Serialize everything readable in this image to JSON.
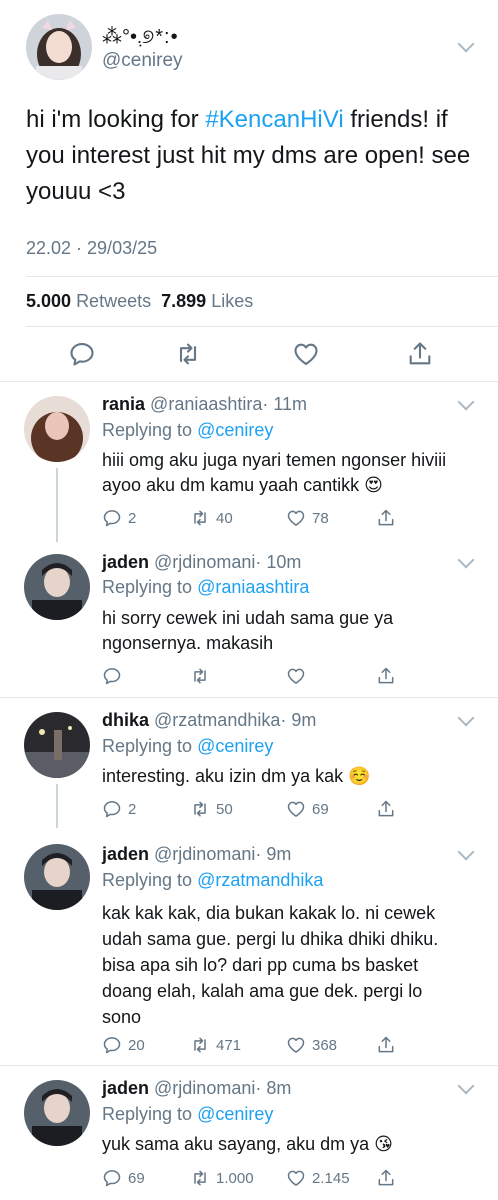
{
  "main_tweet": {
    "display_name": "⁂°•.ٜ୭*:•",
    "handle": "@cenirey",
    "text_before": "hi i'm looking for ",
    "hashtag": "#KencanHiVi",
    "text_after": " friends! if you interest just hit my dms are open! see youuu <3",
    "timestamp": "22.02 · 29/03/25",
    "retweets_count": "5.000",
    "retweets_label": "Retweets",
    "likes_count": "7.899",
    "likes_label": "Likes"
  },
  "replies": [
    {
      "name": "rania",
      "handle": "@raniaashtira",
      "time": "· 11m",
      "replying_label": "Replying to",
      "replying_to": "@cenirey",
      "text": "hiii omg aku juga nyari temen ngonser hiviii ayoo aku dm kamu yaah cantikk 😍",
      "reply_count": "2",
      "retweet_count": "40",
      "like_count": "78"
    },
    {
      "name": "jaden",
      "handle": "@rjdinomani",
      "time": "· 10m",
      "replying_label": "Replying to",
      "replying_to": "@raniaashtira",
      "text": "hi sorry cewek ini udah sama gue ya ngonsernya. makasih",
      "reply_count": "",
      "retweet_count": "",
      "like_count": ""
    },
    {
      "name": "dhika",
      "handle": "@rzatmandhika",
      "time": "· 9m",
      "replying_label": "Replying to",
      "replying_to": "@cenirey",
      "text": "interesting. aku izin dm ya kak ☺️",
      "reply_count": "2",
      "retweet_count": "50",
      "like_count": "69"
    },
    {
      "name": "jaden",
      "handle": "@rjdinomani",
      "time": "· 9m",
      "replying_label": "Replying to",
      "replying_to": "@rzatmandhika",
      "text": "kak kak kak, dia bukan kakak lo. ni cewek udah sama gue. pergi lu dhika dhiki dhiku. bisa apa sih lo? dari pp cuma bs basket doang elah, kalah ama gue dek. pergi lo sono",
      "reply_count": "20",
      "retweet_count": "471",
      "like_count": "368"
    },
    {
      "name": "jaden",
      "handle": "@rjdinomani",
      "time": "· 8m",
      "replying_label": "Replying to",
      "replying_to": "@cenirey",
      "text": "yuk sama aku sayang, aku dm ya 😘",
      "reply_count": "69",
      "retweet_count": "1.000",
      "like_count": "2.145"
    }
  ],
  "icons": {
    "reply": "speech-bubble-icon",
    "retweet": "retweet-icon",
    "like": "heart-icon",
    "share": "share-icon",
    "more": "chevron-down-icon"
  },
  "colors": {
    "link_blue": "#1da1f2",
    "muted_gray": "#657786",
    "divider": "#e1e8ed"
  }
}
